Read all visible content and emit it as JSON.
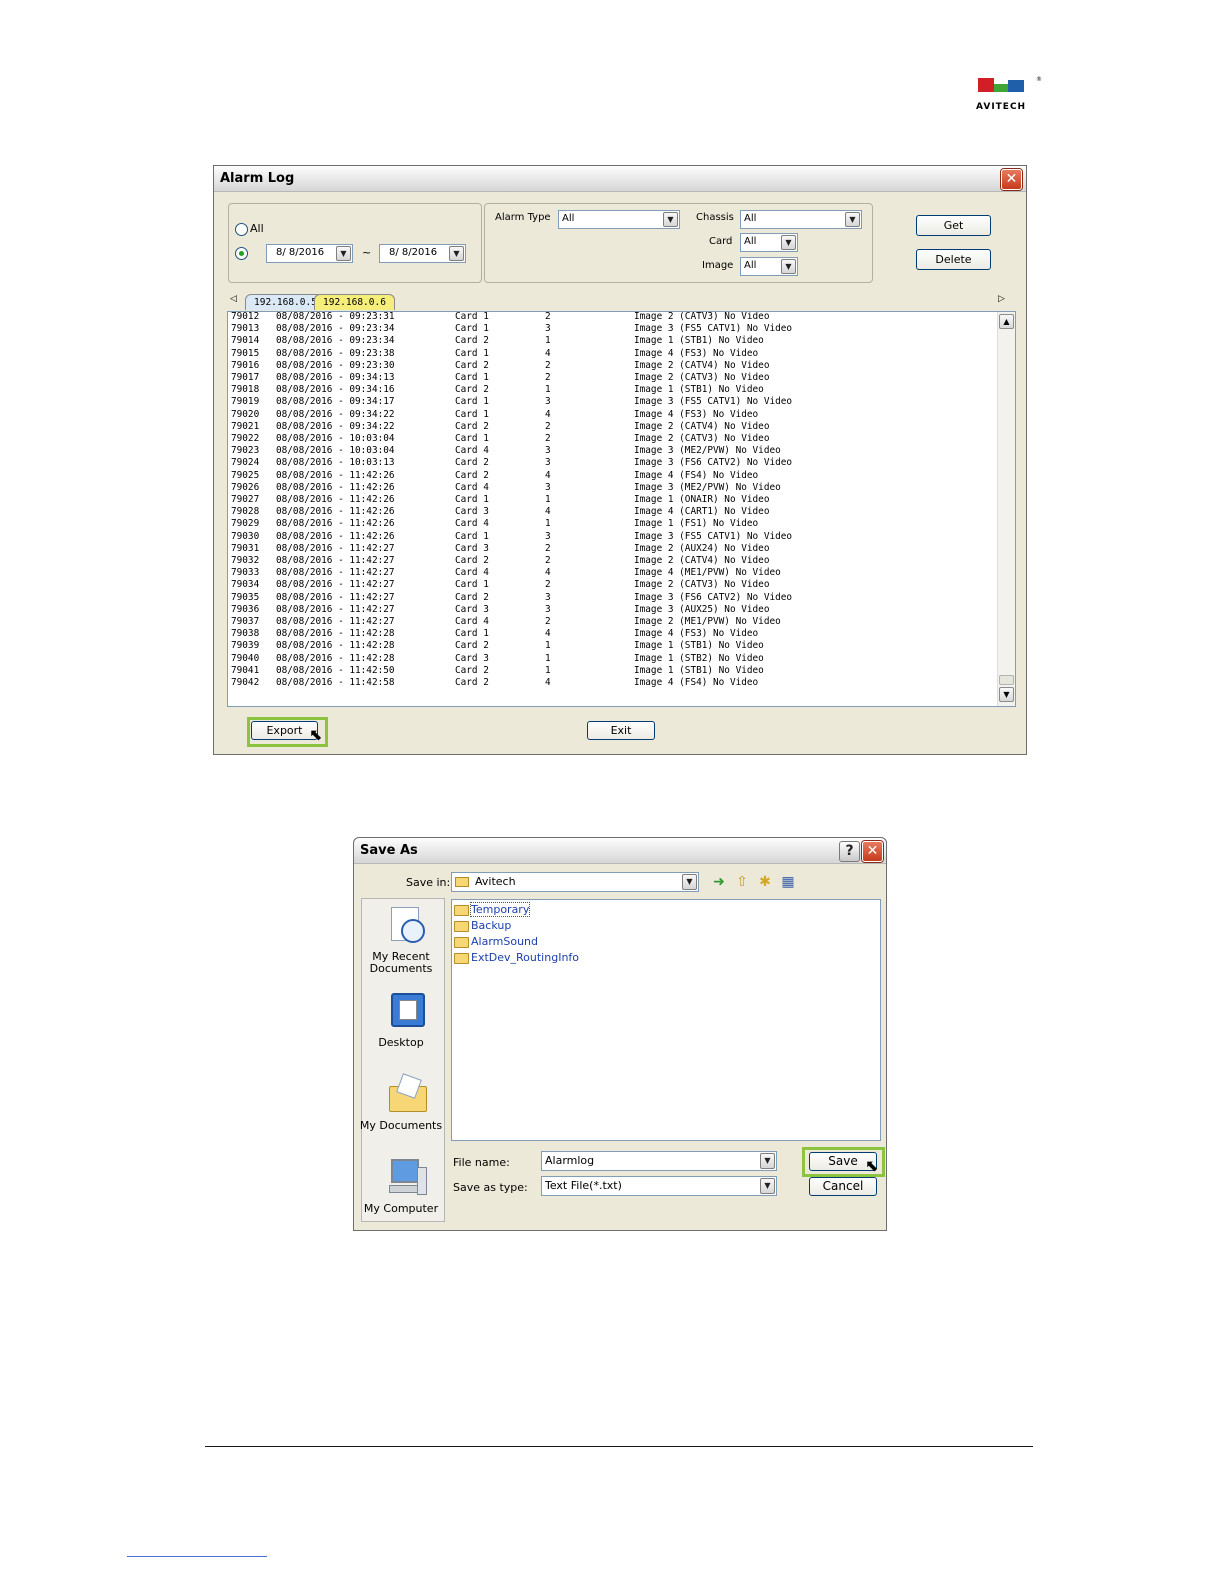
{
  "logo": {
    "text": "AVITECH",
    "reg": "®",
    "colors": [
      "#d21f26",
      "#3fa535",
      "#1f5ea8"
    ]
  },
  "alarm_log": {
    "title": "Alarm Log",
    "close": "✕",
    "radio_all": "All",
    "date_from": "8/  8/2016",
    "date_to": "8/  8/2016",
    "date_sep": "~",
    "alarm_type_label": "Alarm Type",
    "alarm_type_value": "All",
    "chassis_label": "Chassis",
    "chassis_value": "All",
    "card_label": "Card",
    "card_value": "All",
    "image_label": "Image",
    "image_value": "All",
    "get_label": "Get",
    "delete_label": "Delete",
    "tabs": [
      "192.168.0.5",
      "192.168.0.6"
    ],
    "rows": [
      [
        "79012",
        "08/08/2016 - 09:23:31",
        "Card 1",
        "2",
        "Image 2 (CATV3) No Video"
      ],
      [
        "79013",
        "08/08/2016 - 09:23:34",
        "Card 1",
        "3",
        "Image 3 (FS5 CATV1) No Video"
      ],
      [
        "79014",
        "08/08/2016 - 09:23:34",
        "Card 2",
        "1",
        "Image 1 (STB1) No Video"
      ],
      [
        "79015",
        "08/08/2016 - 09:23:38",
        "Card 1",
        "4",
        "Image 4 (FS3) No Video"
      ],
      [
        "79016",
        "08/08/2016 - 09:23:30",
        "Card 2",
        "2",
        "Image 2 (CATV4) No Video"
      ],
      [
        "79017",
        "08/08/2016 - 09:34:13",
        "Card 1",
        "2",
        "Image 2 (CATV3) No Video"
      ],
      [
        "79018",
        "08/08/2016 - 09:34:16",
        "Card 2",
        "1",
        "Image 1 (STB1) No Video"
      ],
      [
        "79019",
        "08/08/2016 - 09:34:17",
        "Card 1",
        "3",
        "Image 3 (FS5 CATV1) No Video"
      ],
      [
        "79020",
        "08/08/2016 - 09:34:22",
        "Card 1",
        "4",
        "Image 4 (FS3) No Video"
      ],
      [
        "79021",
        "08/08/2016 - 09:34:22",
        "Card 2",
        "2",
        "Image 2 (CATV4) No Video"
      ],
      [
        "79022",
        "08/08/2016 - 10:03:04",
        "Card 1",
        "2",
        "Image 2 (CATV3) No Video"
      ],
      [
        "79023",
        "08/08/2016 - 10:03:04",
        "Card 4",
        "3",
        "Image 3 (ME2/PVW) No Video"
      ],
      [
        "79024",
        "08/08/2016 - 10:03:13",
        "Card 2",
        "3",
        "Image 3 (FS6 CATV2) No Video"
      ],
      [
        "79025",
        "08/08/2016 - 11:42:26",
        "Card 2",
        "4",
        "Image 4 (FS4) No Video"
      ],
      [
        "79026",
        "08/08/2016 - 11:42:26",
        "Card 4",
        "3",
        "Image 3 (ME2/PVW) No Video"
      ],
      [
        "79027",
        "08/08/2016 - 11:42:26",
        "Card 1",
        "1",
        "Image 1 (ONAIR) No Video"
      ],
      [
        "79028",
        "08/08/2016 - 11:42:26",
        "Card 3",
        "4",
        "Image 4 (CART1) No Video"
      ],
      [
        "79029",
        "08/08/2016 - 11:42:26",
        "Card 4",
        "1",
        "Image 1 (FS1) No Video"
      ],
      [
        "79030",
        "08/08/2016 - 11:42:26",
        "Card 1",
        "3",
        "Image 3 (FS5 CATV1) No Video"
      ],
      [
        "79031",
        "08/08/2016 - 11:42:27",
        "Card 3",
        "2",
        "Image 2 (AUX24) No Video"
      ],
      [
        "79032",
        "08/08/2016 - 11:42:27",
        "Card 2",
        "2",
        "Image 2 (CATV4) No Video"
      ],
      [
        "79033",
        "08/08/2016 - 11:42:27",
        "Card 4",
        "4",
        "Image 4 (ME1/PVW) No Video"
      ],
      [
        "79034",
        "08/08/2016 - 11:42:27",
        "Card 1",
        "2",
        "Image 2 (CATV3) No Video"
      ],
      [
        "79035",
        "08/08/2016 - 11:42:27",
        "Card 2",
        "3",
        "Image 3 (FS6 CATV2) No Video"
      ],
      [
        "79036",
        "08/08/2016 - 11:42:27",
        "Card 3",
        "3",
        "Image 3 (AUX25) No Video"
      ],
      [
        "79037",
        "08/08/2016 - 11:42:27",
        "Card 4",
        "2",
        "Image 2 (ME1/PVW) No Video"
      ],
      [
        "79038",
        "08/08/2016 - 11:42:28",
        "Card 1",
        "4",
        "Image 4 (FS3) No Video"
      ],
      [
        "79039",
        "08/08/2016 - 11:42:28",
        "Card 2",
        "1",
        "Image 1 (STB1) No Video"
      ],
      [
        "79040",
        "08/08/2016 - 11:42:28",
        "Card 3",
        "1",
        "Image 1 (STB2) No Video"
      ],
      [
        "79041",
        "08/08/2016 - 11:42:50",
        "Card 2",
        "1",
        "Image 1 (STB1) No Video"
      ],
      [
        "79042",
        "08/08/2016 - 11:42:58",
        "Card 2",
        "4",
        "Image 4 (FS4) No Video"
      ]
    ],
    "export_label": "Export",
    "exit_label": "Exit"
  },
  "save_as": {
    "title": "Save As",
    "help": "?",
    "close": "✕",
    "save_in_label": "Save in:",
    "save_in_value": "Avitech",
    "places": [
      "My Recent Documents",
      "Desktop",
      "My Documents",
      "My Computer"
    ],
    "folders": [
      "Temporary",
      "Backup",
      "AlarmSound",
      "ExtDev_RoutingInfo"
    ],
    "file_name_label": "File name:",
    "file_name_value": "Alarmlog",
    "save_type_label": "Save as type:",
    "save_type_value": "Text File(*.txt)",
    "save_label": "Save",
    "cancel_label": "Cancel"
  }
}
